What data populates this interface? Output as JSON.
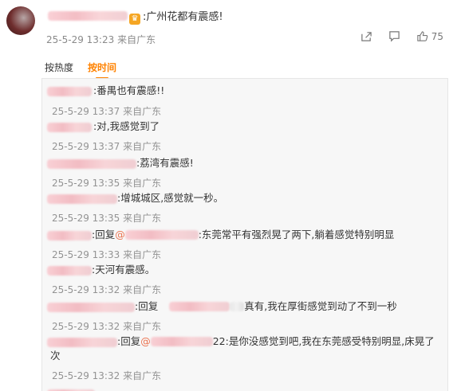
{
  "post": {
    "text": ":广州花都有震感!",
    "time": "25-5-29 13:23",
    "location": "来自广东",
    "share_icon": "share-icon",
    "comment_icon": "comment-icon",
    "like_icon": "like-icon",
    "like_count": "75"
  },
  "sort": {
    "hot": "按热度",
    "time": "按时间"
  },
  "comments": [
    {
      "text": ":番禺也有震感!!",
      "time": "25-5-29 13:37",
      "location": "来自广东"
    },
    {
      "text": ":对,我感觉到了",
      "time": "25-5-29 13:37",
      "location": "来自广东"
    },
    {
      "text": ":荔湾有震感!",
      "time": "25-5-29 13:35",
      "location": "来自广东"
    },
    {
      "text": ":增城城区,感觉就一秒。",
      "time": "25-5-29 13:35",
      "location": "来自广东"
    },
    {
      "prefix": ":回复",
      "at": "@",
      "text": ":东莞常平有强烈晃了两下,躺着感觉特别明显",
      "time": "25-5-29 13:33",
      "location": "来自广东"
    },
    {
      "text": ":天河有震感。",
      "time": "25-5-29 13:32",
      "location": "来自广东"
    },
    {
      "prefix": ":回复",
      "text": "真有,我在厚街感觉到动了不到一秒",
      "time": "25-5-29 13:32",
      "location": "来自广东"
    },
    {
      "prefix": ":回复",
      "at": "@",
      "at_suffix": "22",
      "text": ":是你没感觉到吧,我在东莞感受特别明显,床晃了次",
      "time": "25-5-29 13:32",
      "location": "来自广东"
    }
  ]
}
